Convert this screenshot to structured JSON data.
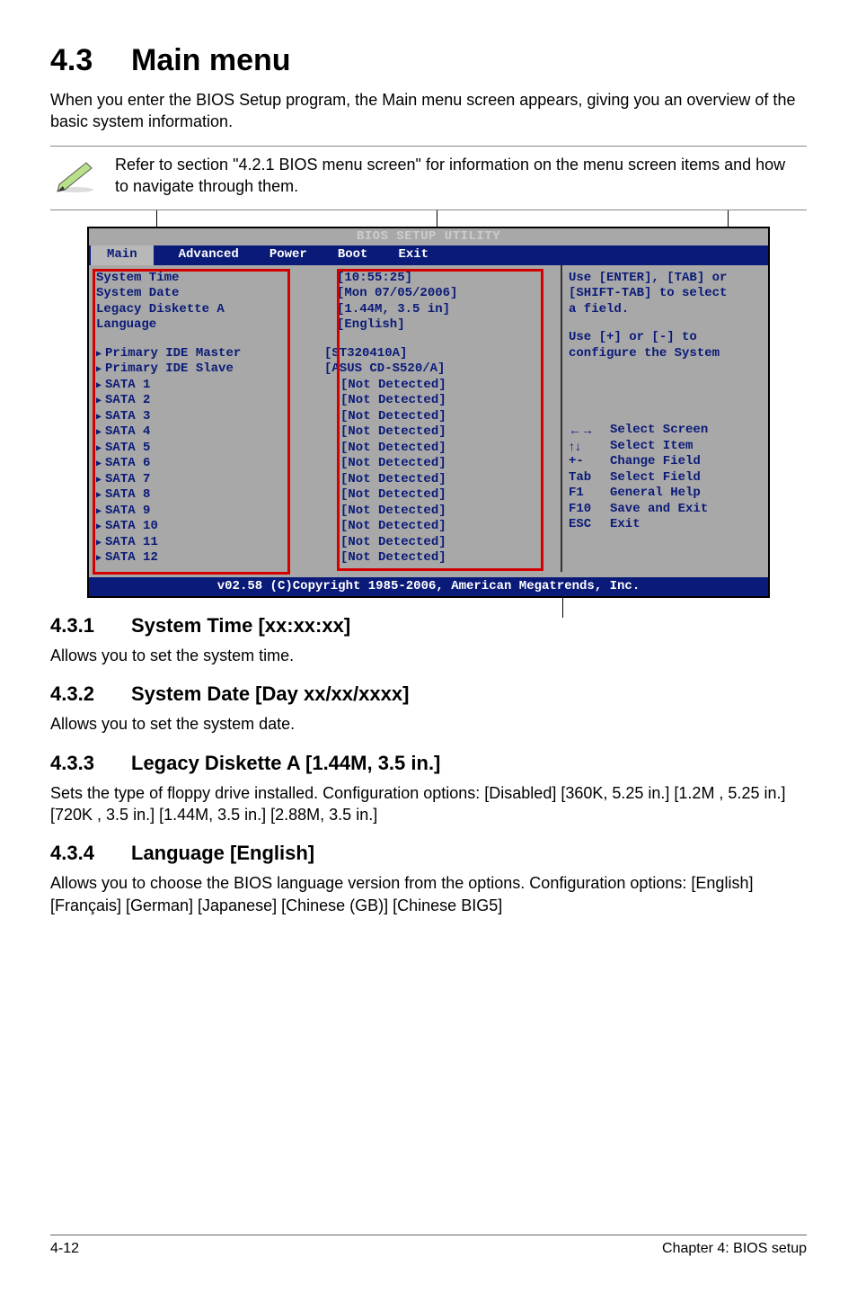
{
  "heading": {
    "num": "4.3",
    "title": "Main menu"
  },
  "intro": "When you enter the BIOS Setup program, the Main menu screen appears, giving you an overview of the basic system information.",
  "note": "Refer to section \"4.2.1  BIOS menu screen\" for information on the menu screen items and how to navigate through them.",
  "bios": {
    "title": "BIOS SETUP UTILITY",
    "tabs": [
      "Main",
      "Advanced",
      "Power",
      "Boot",
      "Exit"
    ],
    "active_tab": 0,
    "rows_top": [
      {
        "label": "System Time",
        "value": "[10:55:25]"
      },
      {
        "label": "System Date",
        "value": "[Mon 07/05/2006]"
      },
      {
        "label": "Legacy Diskette A",
        "value": "[1.44M, 3.5 in]"
      },
      {
        "label": "Language",
        "value": "[English]"
      }
    ],
    "rows_dev": [
      {
        "label": "Primary IDE Master",
        "value": "[ST320410A]"
      },
      {
        "label": "Primary IDE Slave",
        "value": "[ASUS CD-S520/A]"
      },
      {
        "label": "SATA 1",
        "value": "[Not Detected]"
      },
      {
        "label": "SATA 2",
        "value": "[Not Detected]"
      },
      {
        "label": "SATA 3",
        "value": "[Not Detected]"
      },
      {
        "label": "SATA 4",
        "value": "[Not Detected]"
      },
      {
        "label": "SATA 5",
        "value": "[Not Detected]"
      },
      {
        "label": "SATA 6",
        "value": "[Not Detected]"
      },
      {
        "label": "SATA 7",
        "value": "[Not Detected]"
      },
      {
        "label": "SATA 8",
        "value": "[Not Detected]"
      },
      {
        "label": "SATA 9",
        "value": "[Not Detected]"
      },
      {
        "label": "SATA 10",
        "value": "[Not Detected]"
      },
      {
        "label": "SATA 11",
        "value": "[Not Detected]"
      },
      {
        "label": "SATA 12",
        "value": "[Not Detected]"
      }
    ],
    "help_top": [
      "Use [ENTER], [TAB] or",
      "[SHIFT-TAB] to select",
      "a field."
    ],
    "help_mid": [
      "Use [+] or [-] to",
      "configure the System"
    ],
    "help_keys": [
      {
        "k": "←→",
        "d": "Select Screen"
      },
      {
        "k": "↑↓",
        "d": "Select Item"
      },
      {
        "k": "+-",
        "d": "Change Field"
      },
      {
        "k": "Tab",
        "d": "Select Field"
      },
      {
        "k": "F1",
        "d": "General Help"
      },
      {
        "k": "F10",
        "d": "Save and Exit"
      },
      {
        "k": "ESC",
        "d": "Exit"
      }
    ],
    "footer": "v02.58 (C)Copyright 1985-2006, American Megatrends, Inc."
  },
  "sections": [
    {
      "num": "4.3.1",
      "title": "System Time [xx:xx:xx]",
      "body": "Allows you to set the system time."
    },
    {
      "num": "4.3.2",
      "title": "System Date [Day xx/xx/xxxx]",
      "body": "Allows you to set the system date."
    },
    {
      "num": "4.3.3",
      "title": "Legacy Diskette A [1.44M, 3.5 in.]",
      "body": "Sets the type of floppy drive installed. Configuration options: [Disabled] [360K, 5.25 in.] [1.2M , 5.25 in.] [720K , 3.5 in.] [1.44M, 3.5 in.] [2.88M, 3.5 in.]"
    },
    {
      "num": "4.3.4",
      "title": "Language [English]",
      "body": "Allows you to choose the BIOS language version from the options. Configuration options: [English] [Français] [German] [Japanese] [Chinese (GB)] [Chinese BIG5]"
    }
  ],
  "footer": {
    "left": "4-12",
    "right": "Chapter 4: BIOS setup"
  }
}
